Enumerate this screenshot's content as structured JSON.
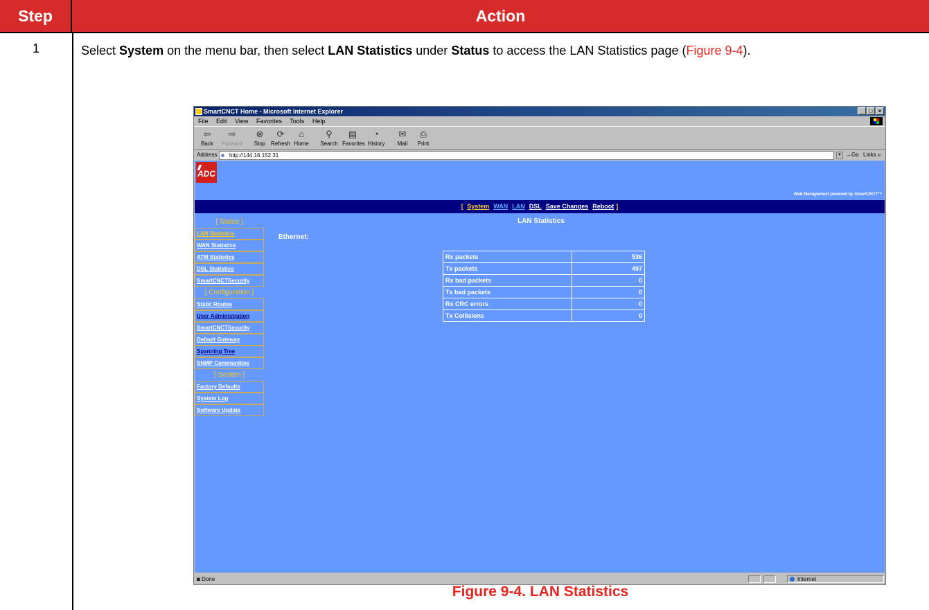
{
  "doc": {
    "header_step": "Step",
    "header_action": "Action",
    "step_number": "1",
    "action_parts": {
      "p1": "Select ",
      "b1": "System",
      "p2": " on the menu bar, then select ",
      "b2": "LAN Statistics",
      "p3": " under ",
      "b3": "Status",
      "p4": " to access the LAN Statistics page (",
      "ref": "Figure 9-4",
      "p5": ")."
    },
    "caption": "Figure 9-4. LAN Statistics",
    "colors": {
      "header_bg": "#d72a2a",
      "reference_text": "#e8231f"
    }
  },
  "browser": {
    "title": "SmartCNCT Home - Microsoft Internet Explorer",
    "menu": [
      "File",
      "Edit",
      "View",
      "Favorites",
      "Tools",
      "Help"
    ],
    "toolbar": [
      {
        "label": "Back",
        "icon": "back-arrow-icon"
      },
      {
        "label": "Forward",
        "icon": "forward-arrow-icon"
      },
      {
        "label": "Stop",
        "icon": "stop-icon"
      },
      {
        "label": "Refresh",
        "icon": "refresh-icon"
      },
      {
        "label": "Home",
        "icon": "home-icon"
      },
      {
        "label": "Search",
        "icon": "search-icon"
      },
      {
        "label": "Favorites",
        "icon": "favorites-icon"
      },
      {
        "label": "History",
        "icon": "history-icon"
      },
      {
        "label": "Mail",
        "icon": "mail-icon"
      },
      {
        "label": "Print",
        "icon": "print-icon"
      }
    ],
    "address_label": "Address",
    "address_value": "http://144.16.152.31",
    "go_label": "Go",
    "links_label": "Links »",
    "status_text": "Done",
    "zone_text": "Internet"
  },
  "app": {
    "logo_text": "ADC",
    "powered_by": "Web Management powered by SmartCNCT™",
    "nav": [
      "System",
      "WAN",
      "LAN",
      "DSL",
      "Save Changes",
      "Reboot"
    ],
    "page_title": "LAN Statistics",
    "section_label": "Ethernet:",
    "sidebar": {
      "status_header": "[ Status ]",
      "status_items": [
        "LAN Statistics",
        "WAN Statistics",
        "ATM Statistics",
        "DSL Statistics",
        "SmartCNCTSecurity"
      ],
      "config_header": "[ Configuration ]",
      "config_items": [
        "Static Routes",
        "User Administration",
        "SmartCNCTSecurity",
        "Default Gateway",
        "Spanning Tree",
        "SNMP Communities"
      ],
      "system_header": "[ System ]",
      "system_items": [
        "Factory Defaults",
        "System Log",
        "Software Update"
      ]
    },
    "stats": [
      {
        "label": "Rx packets",
        "value": "536"
      },
      {
        "label": "Tx packets",
        "value": "497"
      },
      {
        "label": "Rx bad packets",
        "value": "0"
      },
      {
        "label": "Tx bad packets",
        "value": "0"
      },
      {
        "label": "Rx CRC errors",
        "value": "0"
      },
      {
        "label": "Tx Collisions",
        "value": "0"
      }
    ],
    "colors": {
      "page_bg": "#6699ff",
      "navbar_bg": "#000080",
      "accent": "#ffcc00"
    }
  }
}
